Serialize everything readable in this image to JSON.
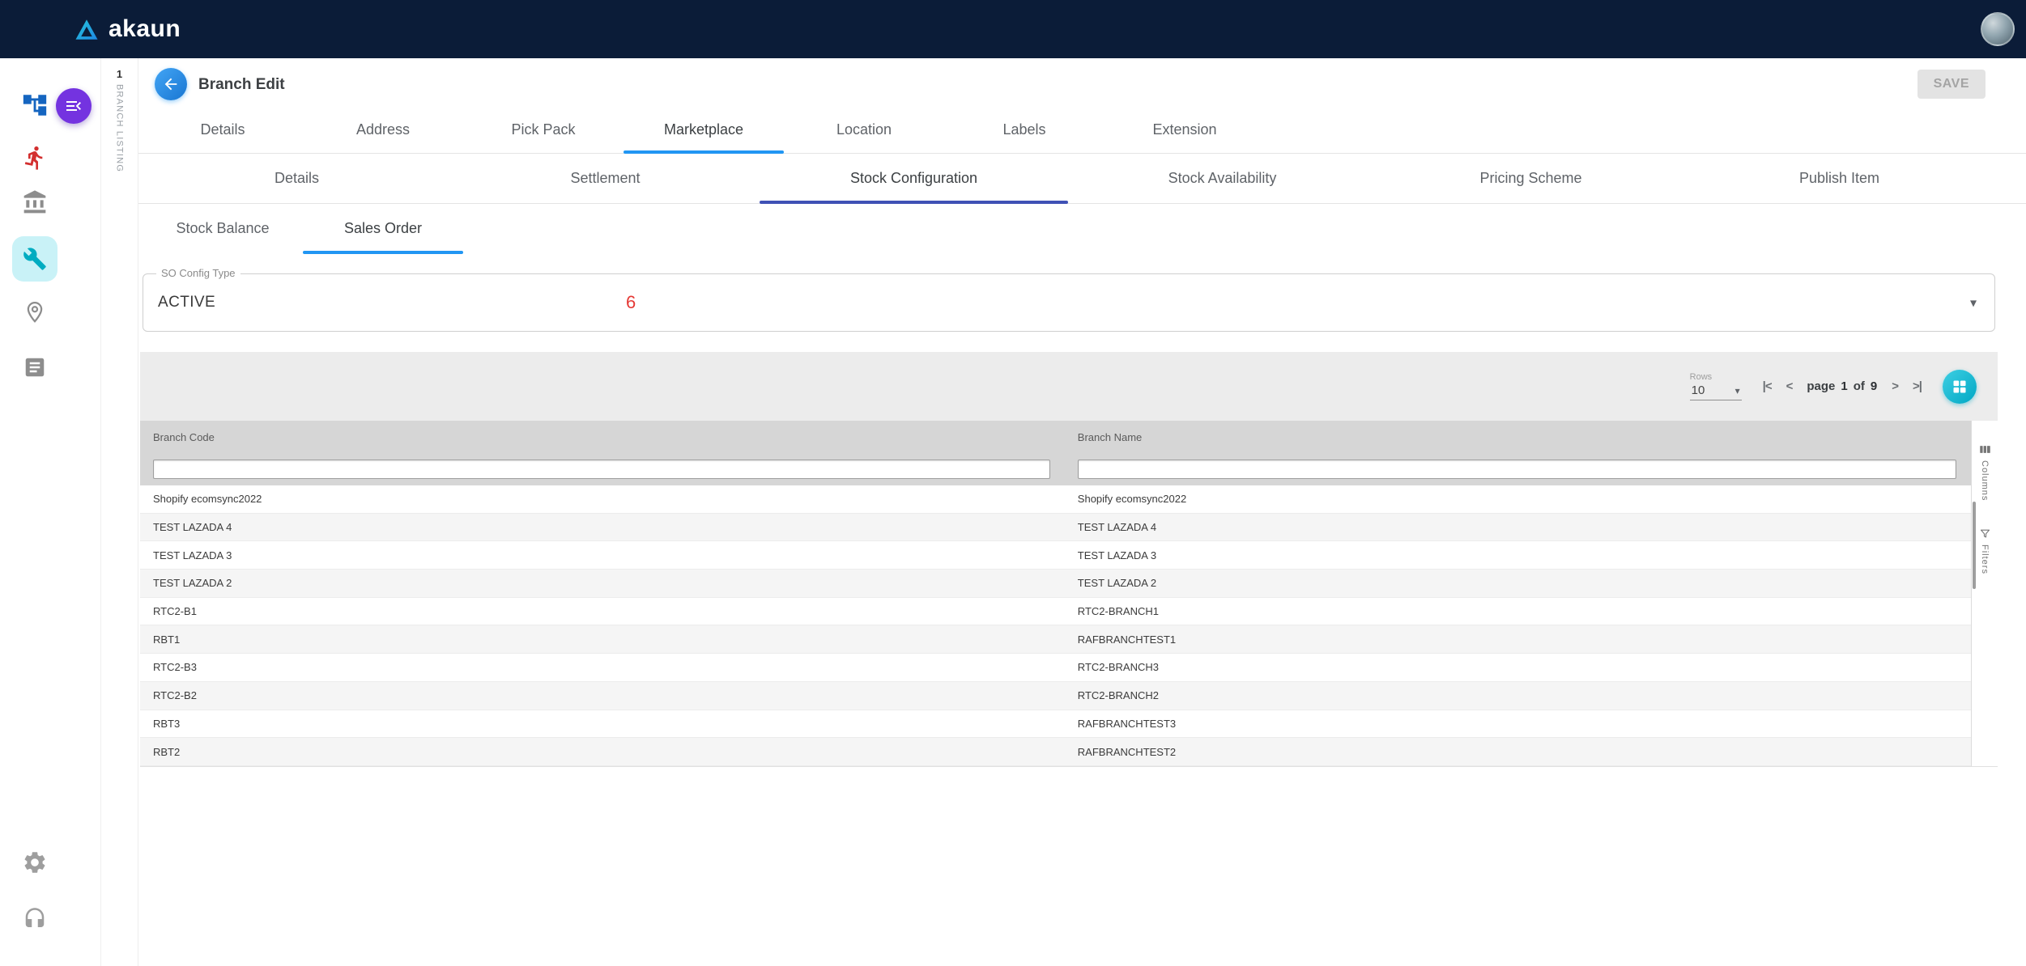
{
  "topbar": {
    "brand": "akaun"
  },
  "sidebar": {
    "icons": [
      "hierarchy-icon",
      "activity-icon",
      "bank-icon",
      "wrench-icon",
      "location-pin-icon",
      "document-icon",
      "settings-gear-icon",
      "support-headset-icon"
    ],
    "toggle_icon": "menu-open-icon"
  },
  "vertical_tab": {
    "number": "1",
    "label": "BRANCH LISTING"
  },
  "header": {
    "title": "Branch Edit",
    "save_label": "SAVE"
  },
  "tabs_primary": {
    "items": [
      "Details",
      "Address",
      "Pick Pack",
      "Marketplace",
      "Location",
      "Labels",
      "Extension"
    ],
    "active": "Marketplace"
  },
  "tabs_secondary": {
    "items": [
      "Details",
      "Settlement",
      "Stock Configuration",
      "Stock Availability",
      "Pricing Scheme",
      "Publish Item"
    ],
    "active": "Stock Configuration"
  },
  "tabs_tertiary": {
    "items": [
      "Stock Balance",
      "Sales Order"
    ],
    "active": "Sales Order"
  },
  "form": {
    "so_config_type": {
      "label": "SO Config Type",
      "value": "ACTIVE"
    }
  },
  "annotation": {
    "value": "6",
    "color": "#e53935"
  },
  "table_toolbar": {
    "rows_label": "Rows",
    "rows_value": "10",
    "pagination": {
      "first": "|<",
      "prev": "<",
      "page_label": "page",
      "current": "1",
      "of_label": "of",
      "total": "9",
      "next": ">",
      "last": ">|"
    }
  },
  "table": {
    "columns": [
      "Branch Code",
      "Branch Name"
    ],
    "filters": [
      "",
      ""
    ],
    "rows": [
      [
        "Shopify ecomsync2022",
        "Shopify ecomsync2022"
      ],
      [
        "TEST LAZADA 4",
        "TEST LAZADA 4"
      ],
      [
        "TEST LAZADA 3",
        "TEST LAZADA 3"
      ],
      [
        "TEST LAZADA 2",
        "TEST LAZADA 2"
      ],
      [
        "RTC2-B1",
        "RTC2-BRANCH1"
      ],
      [
        "RBT1",
        "RAFBRANCHTEST1"
      ],
      [
        "RTC2-B3",
        "RTC2-BRANCH3"
      ],
      [
        "RTC2-B2",
        "RTC2-BRANCH2"
      ],
      [
        "RBT3",
        "RAFBRANCHTEST3"
      ],
      [
        "RBT2",
        "RAFBRANCHTEST2"
      ]
    ]
  },
  "side_panel": {
    "columns_label": "Columns",
    "filters_label": "Filters"
  },
  "colors": {
    "topbar": "#0b1c38",
    "accent_blue": "#2196f3",
    "accent_indigo": "#3f51b5",
    "accent_teal": "#00bcd4",
    "accent_purple": "#7433e0",
    "annotation_red": "#e53935"
  }
}
